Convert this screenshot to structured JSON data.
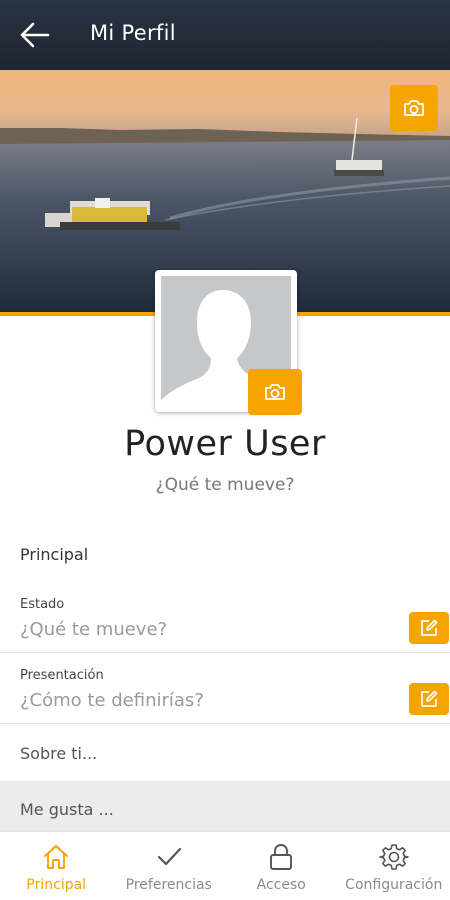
{
  "appbar": {
    "title": "Mi Perfil",
    "back_icon": "arrow-left-icon"
  },
  "cover": {
    "camera_icon": "camera-icon"
  },
  "profile": {
    "name": "Power User",
    "status": "¿Qué te mueve?",
    "camera_icon": "camera-icon"
  },
  "main": {
    "section_title": "Principal",
    "fields": [
      {
        "label": "Estado",
        "placeholder": "¿Qué te mueve?",
        "edit_icon": "edit-icon"
      },
      {
        "label": "Presentación",
        "placeholder": "¿Cómo te definirías?",
        "edit_icon": "edit-icon"
      }
    ],
    "about": "Sobre ti...",
    "likes": "Me gusta ..."
  },
  "bottom_nav": {
    "items": [
      {
        "label": "Principal",
        "icon": "home-icon",
        "active": true
      },
      {
        "label": "Preferencias",
        "icon": "check-icon",
        "active": false
      },
      {
        "label": "Acceso",
        "icon": "lock-icon",
        "active": false
      },
      {
        "label": "Configuración",
        "icon": "gear-icon",
        "active": false
      }
    ]
  },
  "colors": {
    "accent": "#f5a400",
    "appbar": "#1e2531",
    "text_muted": "#9a9a9a"
  }
}
